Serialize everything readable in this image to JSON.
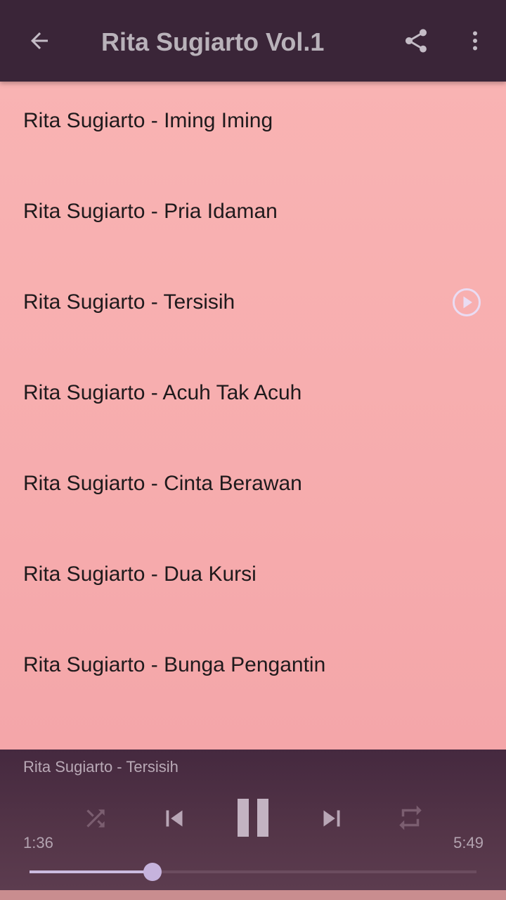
{
  "app_bar": {
    "title": "Rita Sugiarto Vol.1",
    "back_icon": "arrow-back-icon",
    "share_icon": "share-icon",
    "more_icon": "more-vert-icon"
  },
  "songs": [
    {
      "title": "Rita Sugiarto - Iming Iming"
    },
    {
      "title": "Rita Sugiarto - Pria Idaman"
    },
    {
      "title": "Rita Sugiarto - Tersisih",
      "playing": true
    },
    {
      "title": "Rita Sugiarto - Acuh Tak Acuh"
    },
    {
      "title": "Rita Sugiarto - Cinta Berawan"
    },
    {
      "title": "Rita Sugiarto - Dua Kursi"
    },
    {
      "title": "Rita Sugiarto - Bunga Pengantin"
    }
  ],
  "player": {
    "now_playing": "Rita Sugiarto - Tersisih",
    "elapsed": "1:36",
    "duration": "5:49",
    "progress": 0.275,
    "state": "playing",
    "controls": [
      "shuffle-icon",
      "skip-previous-icon",
      "pause-icon",
      "skip-next-icon",
      "repeat-icon"
    ]
  },
  "colors": {
    "toolbar": "#3a2538",
    "list_background": "#f7aeaf",
    "player_background": "#4f3146",
    "accent": "#c6b3dd"
  }
}
